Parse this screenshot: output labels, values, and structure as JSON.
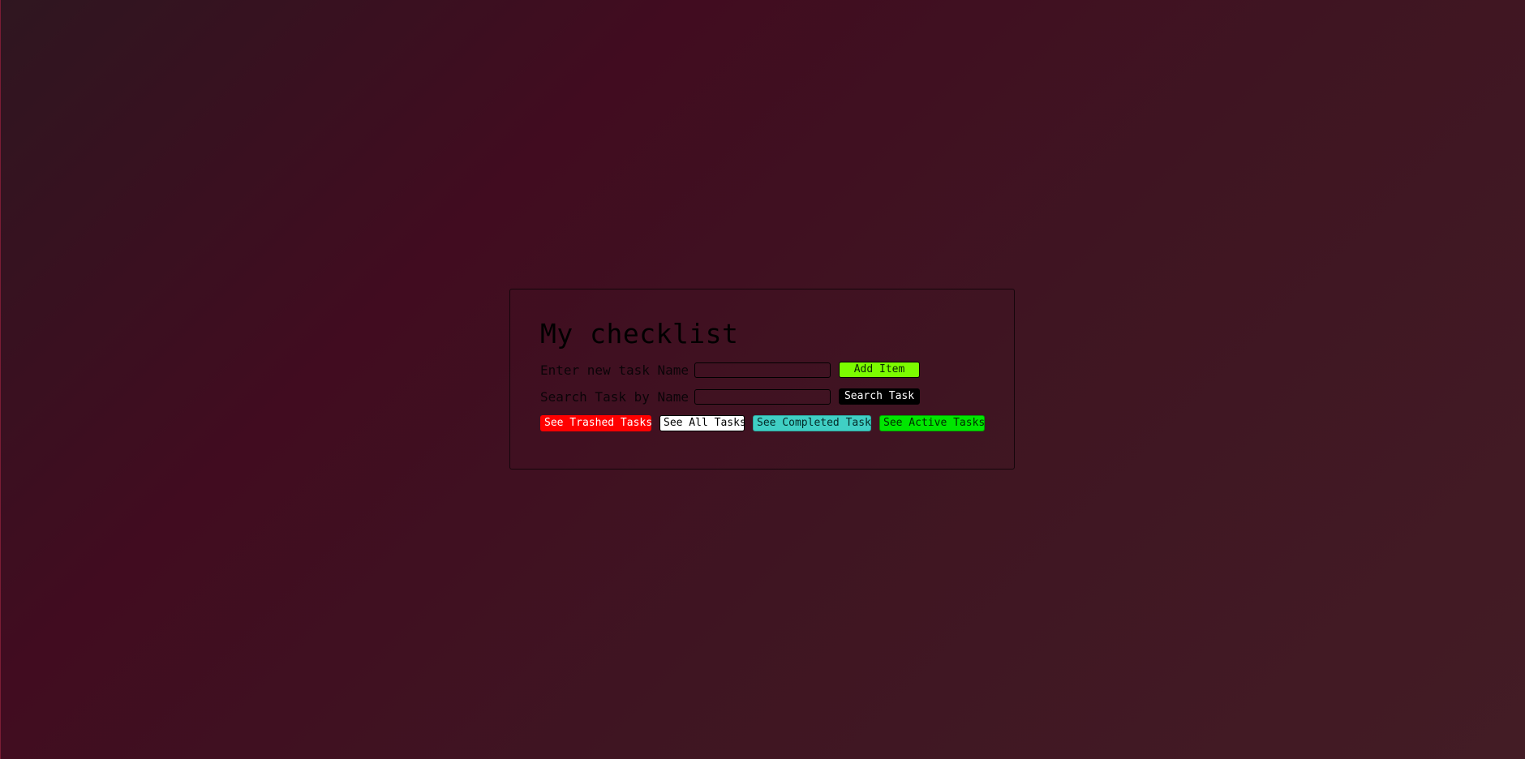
{
  "app": {
    "title": "My checklist"
  },
  "add_task": {
    "label": "Enter new task Name",
    "input_value": "",
    "button_label": "Add Item"
  },
  "search_task": {
    "label": "Search Task by Name",
    "input_value": "",
    "button_label": "Search Task"
  },
  "filters": {
    "trashed": "See Trashed Tasks",
    "all": "See All Tasks",
    "completed": "See Completed Task",
    "active": "See Active Tasks"
  },
  "colors": {
    "add_button": "#7cfc00",
    "search_button": "#000000",
    "trashed_button": "#ff0000",
    "all_button": "#ffffff",
    "completed_button": "#40cfc4",
    "active_button": "#00e600"
  }
}
